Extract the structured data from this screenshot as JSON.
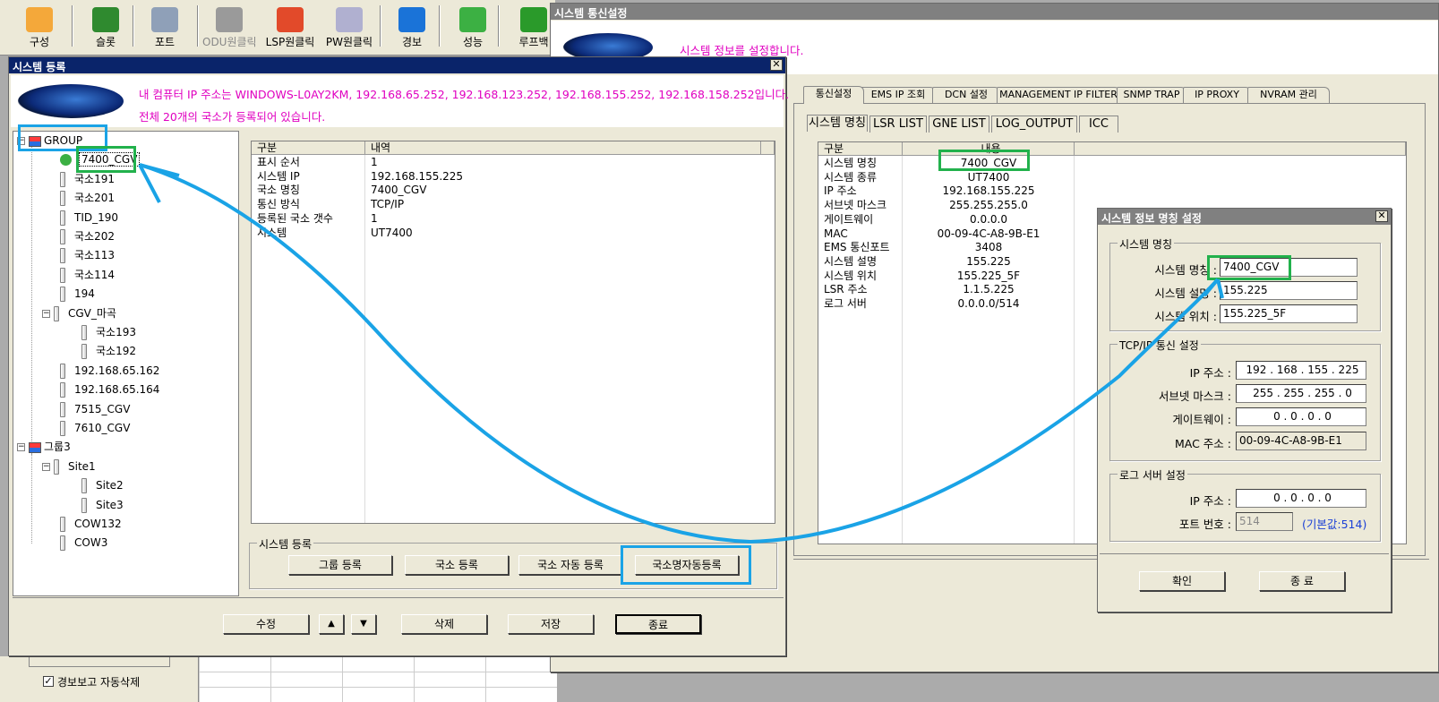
{
  "toolbar": {
    "items": [
      {
        "label": "구성",
        "icon": "config-icon",
        "color": "#f4a83a"
      },
      {
        "label": "슬롯",
        "icon": "slot-icon",
        "color": "#2f8a2f"
      },
      {
        "label": "포트",
        "icon": "port-icon",
        "color": "#8fa0b8"
      },
      {
        "label": "ODU원클릭",
        "icon": "odu-icon",
        "color": "#9a9a9a"
      },
      {
        "label": "LSP원클릭",
        "icon": "lsp-icon",
        "color": "#e24a2a"
      },
      {
        "label": "PW원클릭",
        "icon": "pw-icon",
        "color": "#b0b0d0"
      },
      {
        "label": "경보",
        "icon": "info-icon",
        "color": "#1a73d8"
      },
      {
        "label": "성능",
        "icon": "chart-icon",
        "color": "#3cb043"
      },
      {
        "label": "루프백",
        "icon": "bug-icon",
        "color": "#2a9a2a"
      }
    ]
  },
  "comm_window": {
    "title": "시스템 통신설정",
    "header_msg": "시스템 정보를 설정합니다.",
    "tabs": [
      "통신설정",
      "EMS IP 조회",
      "DCN 설정",
      "MANAGEMENT IP FILTER",
      "SNMP TRAP",
      "IP PROXY",
      "NVRAM 관리"
    ],
    "subtabs": [
      "시스템 명칭",
      "LSR LIST",
      "GNE LIST",
      "LOG_OUTPUT",
      "ICC"
    ],
    "grid": {
      "headers": [
        "구분",
        "내용"
      ],
      "rows": [
        [
          "시스템 명칭",
          "7400_CGV"
        ],
        [
          "시스템 종류",
          "UT7400"
        ],
        [
          "IP 주소",
          "192.168.155.225"
        ],
        [
          "서브넷 마스크",
          "255.255.255.0"
        ],
        [
          "게이트웨이",
          "0.0.0.0"
        ],
        [
          "MAC",
          "00-09-4C-A8-9B-E1"
        ],
        [
          "EMS 통신포트",
          "3408"
        ],
        [
          "시스템 설명",
          "155.225"
        ],
        [
          "시스템 위치",
          "155.225_5F"
        ],
        [
          "LSR 주소",
          "1.1.5.225"
        ],
        [
          "로그 서버",
          "0.0.0.0/514"
        ]
      ]
    }
  },
  "reg_window": {
    "title": "시스템 등록",
    "msg1": "내 컴퓨터 IP 주소는 WINDOWS-L0AY2KM, 192.168.65.252, 192.168.123.252, 192.168.155.252, 192.168.158.252입니다.",
    "msg2": "전체 20개의 국소가 등록되어 있습니다.",
    "tree": [
      {
        "label": "GROUP",
        "level": 0,
        "type": "group"
      },
      {
        "label": "7400_CGV",
        "level": 1,
        "type": "selected"
      },
      {
        "label": "국소191",
        "level": 1,
        "type": "node"
      },
      {
        "label": "국소201",
        "level": 1,
        "type": "node"
      },
      {
        "label": "TID_190",
        "level": 1,
        "type": "node"
      },
      {
        "label": "국소202",
        "level": 1,
        "type": "node"
      },
      {
        "label": "국소113",
        "level": 1,
        "type": "node"
      },
      {
        "label": "국소114",
        "level": 1,
        "type": "node"
      },
      {
        "label": "194",
        "level": 1,
        "type": "node"
      },
      {
        "label": "CGV_마곡",
        "level": 1,
        "type": "folder"
      },
      {
        "label": "국소193",
        "level": 2,
        "type": "node"
      },
      {
        "label": "국소192",
        "level": 2,
        "type": "node"
      },
      {
        "label": "192.168.65.162",
        "level": 1,
        "type": "node"
      },
      {
        "label": "192.168.65.164",
        "level": 1,
        "type": "node"
      },
      {
        "label": "7515_CGV",
        "level": 1,
        "type": "node"
      },
      {
        "label": "7610_CGV",
        "level": 1,
        "type": "node"
      },
      {
        "label": "그룹3",
        "level": 0,
        "type": "group"
      },
      {
        "label": "Site1",
        "level": 1,
        "type": "folder"
      },
      {
        "label": "Site2",
        "level": 2,
        "type": "node"
      },
      {
        "label": "Site3",
        "level": 2,
        "type": "node"
      },
      {
        "label": "COW132",
        "level": 1,
        "type": "node"
      },
      {
        "label": "COW3",
        "level": 1,
        "type": "node"
      }
    ],
    "grid": {
      "headers": [
        "구분",
        "내역"
      ],
      "rows": [
        [
          "표시 순서",
          "1"
        ],
        [
          "시스템 IP",
          "192.168.155.225"
        ],
        [
          "국소 명칭",
          "7400_CGV"
        ],
        [
          "통신 방식",
          "TCP/IP"
        ],
        [
          "등록된 국소 갯수",
          "1"
        ],
        [
          "시스템",
          "UT7400"
        ]
      ]
    },
    "reg_group_title": "시스템 등록",
    "buttons": {
      "group_reg": "그룹 등록",
      "site_reg": "국소 등록",
      "site_auto": "국소 자동 등록",
      "name_auto": "국소명자동등록"
    },
    "bottom": {
      "edit": "수정",
      "up": "▲",
      "down": "▼",
      "delete": "삭제",
      "save": "저장",
      "close": "종료"
    }
  },
  "name_dialog": {
    "title": "시스템 정보 명칭 설정",
    "sys_group": "시스템 명칭",
    "name_label": "시스템 명칭 :",
    "name_value": "7400_CGV",
    "desc_label": "시스템 설명 :",
    "desc_value": "155.225",
    "loc_label": "시스템 위치 :",
    "loc_value": "155.225_5F",
    "tcp_group": "TCP/IP 통신 설정",
    "ip_label": "IP 주소 :",
    "ip_value": "192 . 168 . 155 . 225",
    "mask_label": "서브넷 마스크 :",
    "mask_value": "255 . 255 . 255 .  0",
    "gw_label": "게이트웨이 :",
    "gw_value": "0  .  0  .  0  .  0",
    "mac_label": "MAC 주소 :",
    "mac_value": "00-09-4C-A8-9B-E1",
    "log_group": "로그 서버 설정",
    "log_ip_label": "IP 주소 :",
    "log_ip_value": "0  .  0  .  0  .  0",
    "port_label": "포트 번호 :",
    "port_value": "514",
    "port_hint": "(기본값:514)",
    "ok": "확인",
    "close": "종 료"
  },
  "background": {
    "checkbox_label": "경보보고 자동삭제"
  },
  "colors": {
    "highlight_blue": "#1aa3e6",
    "highlight_green": "#22b14c",
    "message_magenta": "#e000c0",
    "hint_blue": "#1a3fd6",
    "titlebar": "#0a246a"
  }
}
